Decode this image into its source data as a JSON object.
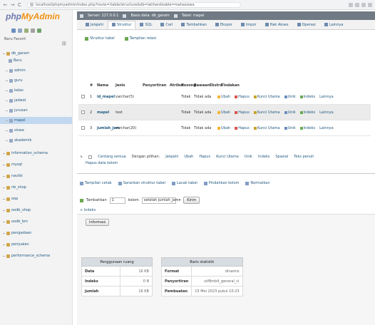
{
  "browser": {
    "url": "localhost/phpmyadmin/index.php?route=/table/structure&db=latihan&table=mahasiswa",
    "nav_back": "←",
    "nav_forward": "→",
    "nav_reload": "C"
  },
  "sidebar": {
    "logo_php": "php",
    "logo_my": "MyAdmin",
    "recent_label": "Baru   Favorit",
    "link_icon": "⛓",
    "items": [
      {
        "label": "db_garam"
      },
      {
        "label": "Baru"
      },
      {
        "label": "admin"
      },
      {
        "label": "guru"
      },
      {
        "label": "kelas"
      },
      {
        "label": "jadwal"
      },
      {
        "label": "jurusan"
      },
      {
        "label": "mapel"
      },
      {
        "label": "siswa"
      },
      {
        "label": "akademik"
      },
      {
        "label": "information_schema"
      },
      {
        "label": "mysql"
      },
      {
        "label": "naufal"
      },
      {
        "label": "nb_shop"
      },
      {
        "label": "oop"
      },
      {
        "label": "oodb_shop"
      },
      {
        "label": "oodb_bm"
      },
      {
        "label": "pengadaan"
      },
      {
        "label": "penjualan"
      },
      {
        "label": "performance_schema"
      }
    ]
  },
  "topbar": {
    "server": "Server: 127.0.0.1",
    "database": "Basis data: db_garam",
    "table": "Tabel: mapel"
  },
  "tabs": [
    {
      "label": "Jelajahi"
    },
    {
      "label": "Struktur"
    },
    {
      "label": "SQL"
    },
    {
      "label": "Cari"
    },
    {
      "label": "Tambahkan"
    },
    {
      "label": "Ekspor"
    },
    {
      "label": "Impor"
    },
    {
      "label": "Hak Akses"
    },
    {
      "label": "Operasi"
    },
    {
      "label": "Lainnya"
    }
  ],
  "subtabs": [
    {
      "label": "Struktur tabel"
    },
    {
      "label": "Tampilan relasi"
    }
  ],
  "structure": {
    "headers": [
      "#",
      "Nama",
      "Jenis",
      "Penyortiran",
      "Atribut",
      "Kosong",
      "Bawaan",
      "Ekstra",
      "Tindakan"
    ],
    "rows": [
      {
        "num": "1",
        "name": "id_mapel",
        "type": "varchar(5)",
        "collation": "",
        "null": "Tidak",
        "default": "Tidak ada"
      },
      {
        "num": "2",
        "name": "mapel",
        "type": "text",
        "collation": "",
        "null": "Tidak",
        "default": "Tidak ada"
      },
      {
        "num": "3",
        "name": "jumlah_jam",
        "type": "varchar(20)",
        "collation": "",
        "null": "Tidak",
        "default": "Tidak ada"
      }
    ],
    "actions": [
      "Ubah",
      "Hapus",
      "Kunci Utama",
      "Unik",
      "Indeks",
      "Lainnya"
    ]
  },
  "bulk": {
    "line1": [
      "Centang semua",
      "Dengan pilihan:",
      "Jelajahi",
      "Ubah",
      "Hapus",
      "Kunci Utama",
      "Unik",
      "Indeks",
      "Spasial",
      "Teks penuh"
    ],
    "line2": [
      "Hapus data kolom"
    ]
  },
  "tools": [
    "Tampilan cetak",
    "Sarankan struktur tabel",
    "Lacak tabel",
    "Pindahkan kolom",
    "Normalkan"
  ],
  "add_column": {
    "prefix": "Tambahkan",
    "count": "1",
    "unit": "kolom",
    "position": "setelah jumlah_jam",
    "go": "Kirim"
  },
  "index_label": "+ Indeks",
  "info_button": "Informasi",
  "space_usage": {
    "title": "Penggunaan ruang",
    "rows": [
      {
        "k": "Data",
        "v": "16 KB"
      },
      {
        "k": "Indeks",
        "v": "0 B"
      },
      {
        "k": "Jumlah",
        "v": "16 KB"
      }
    ]
  },
  "row_stats": {
    "title": "Baris statistik",
    "rows": [
      {
        "k": "Format",
        "v": "dinamis"
      },
      {
        "k": "Penyortiran",
        "v": "utf8mb4_general_ci"
      },
      {
        "k": "Pembuatan",
        "v": "15 Mei 2023 pukul 10:23"
      }
    ]
  },
  "colors": {
    "accent": "#235a81",
    "topbar": "#707a84",
    "selected": "#c2d8ee",
    "ubah": "#f2b632",
    "hapus": "#d9534f"
  }
}
